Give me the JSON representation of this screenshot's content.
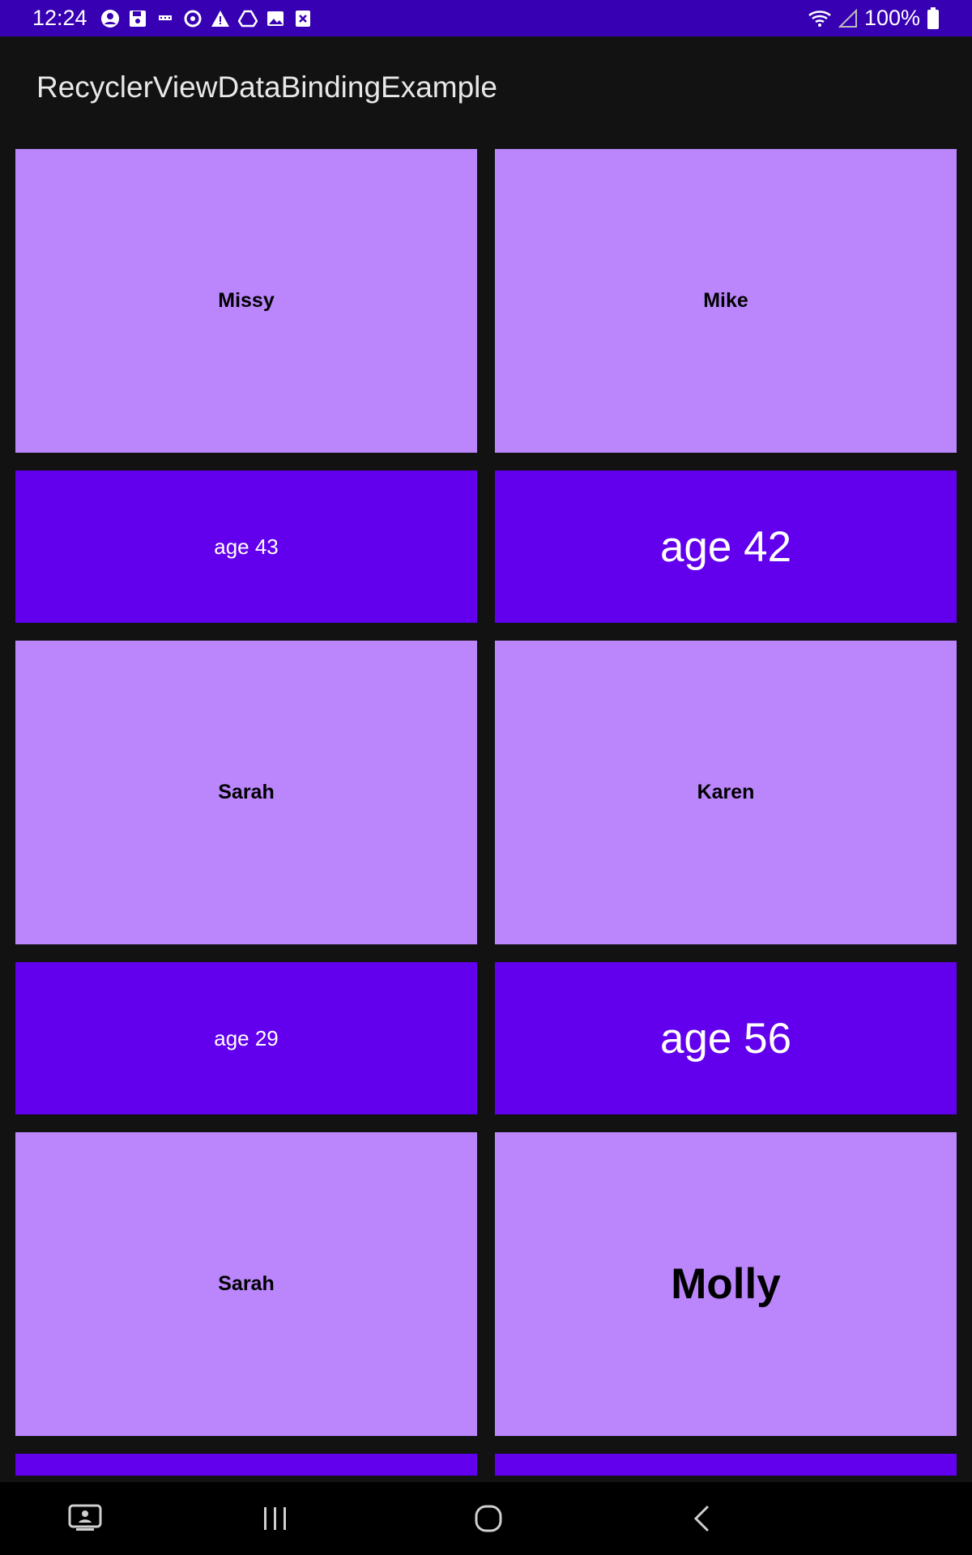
{
  "status_bar": {
    "time": "12:24",
    "battery": "100%",
    "notification_icons": [
      "account-circle-icon",
      "save-icon",
      "debug-icon",
      "sync-icon",
      "warning-icon",
      "drive-icon",
      "image-icon",
      "close-box-icon"
    ]
  },
  "app_bar": {
    "title": "RecyclerViewDataBindingExample"
  },
  "colors": {
    "status_bar": "#3700b3",
    "background": "#121212",
    "name_card": "#bb86fc",
    "age_card": "#6200ee"
  },
  "grid": {
    "row1": {
      "left": "Missy",
      "right": "Mike"
    },
    "row2": {
      "left": "age 43",
      "right": "age 42"
    },
    "row3": {
      "left": "Sarah",
      "right": "Karen"
    },
    "row4": {
      "left": "age 29",
      "right": "age 56"
    },
    "row5": {
      "left": "Sarah",
      "right": "Molly"
    }
  },
  "nav_bar": {
    "icons": [
      "recent-screen-icon",
      "recents-icon",
      "home-icon",
      "back-icon"
    ]
  }
}
